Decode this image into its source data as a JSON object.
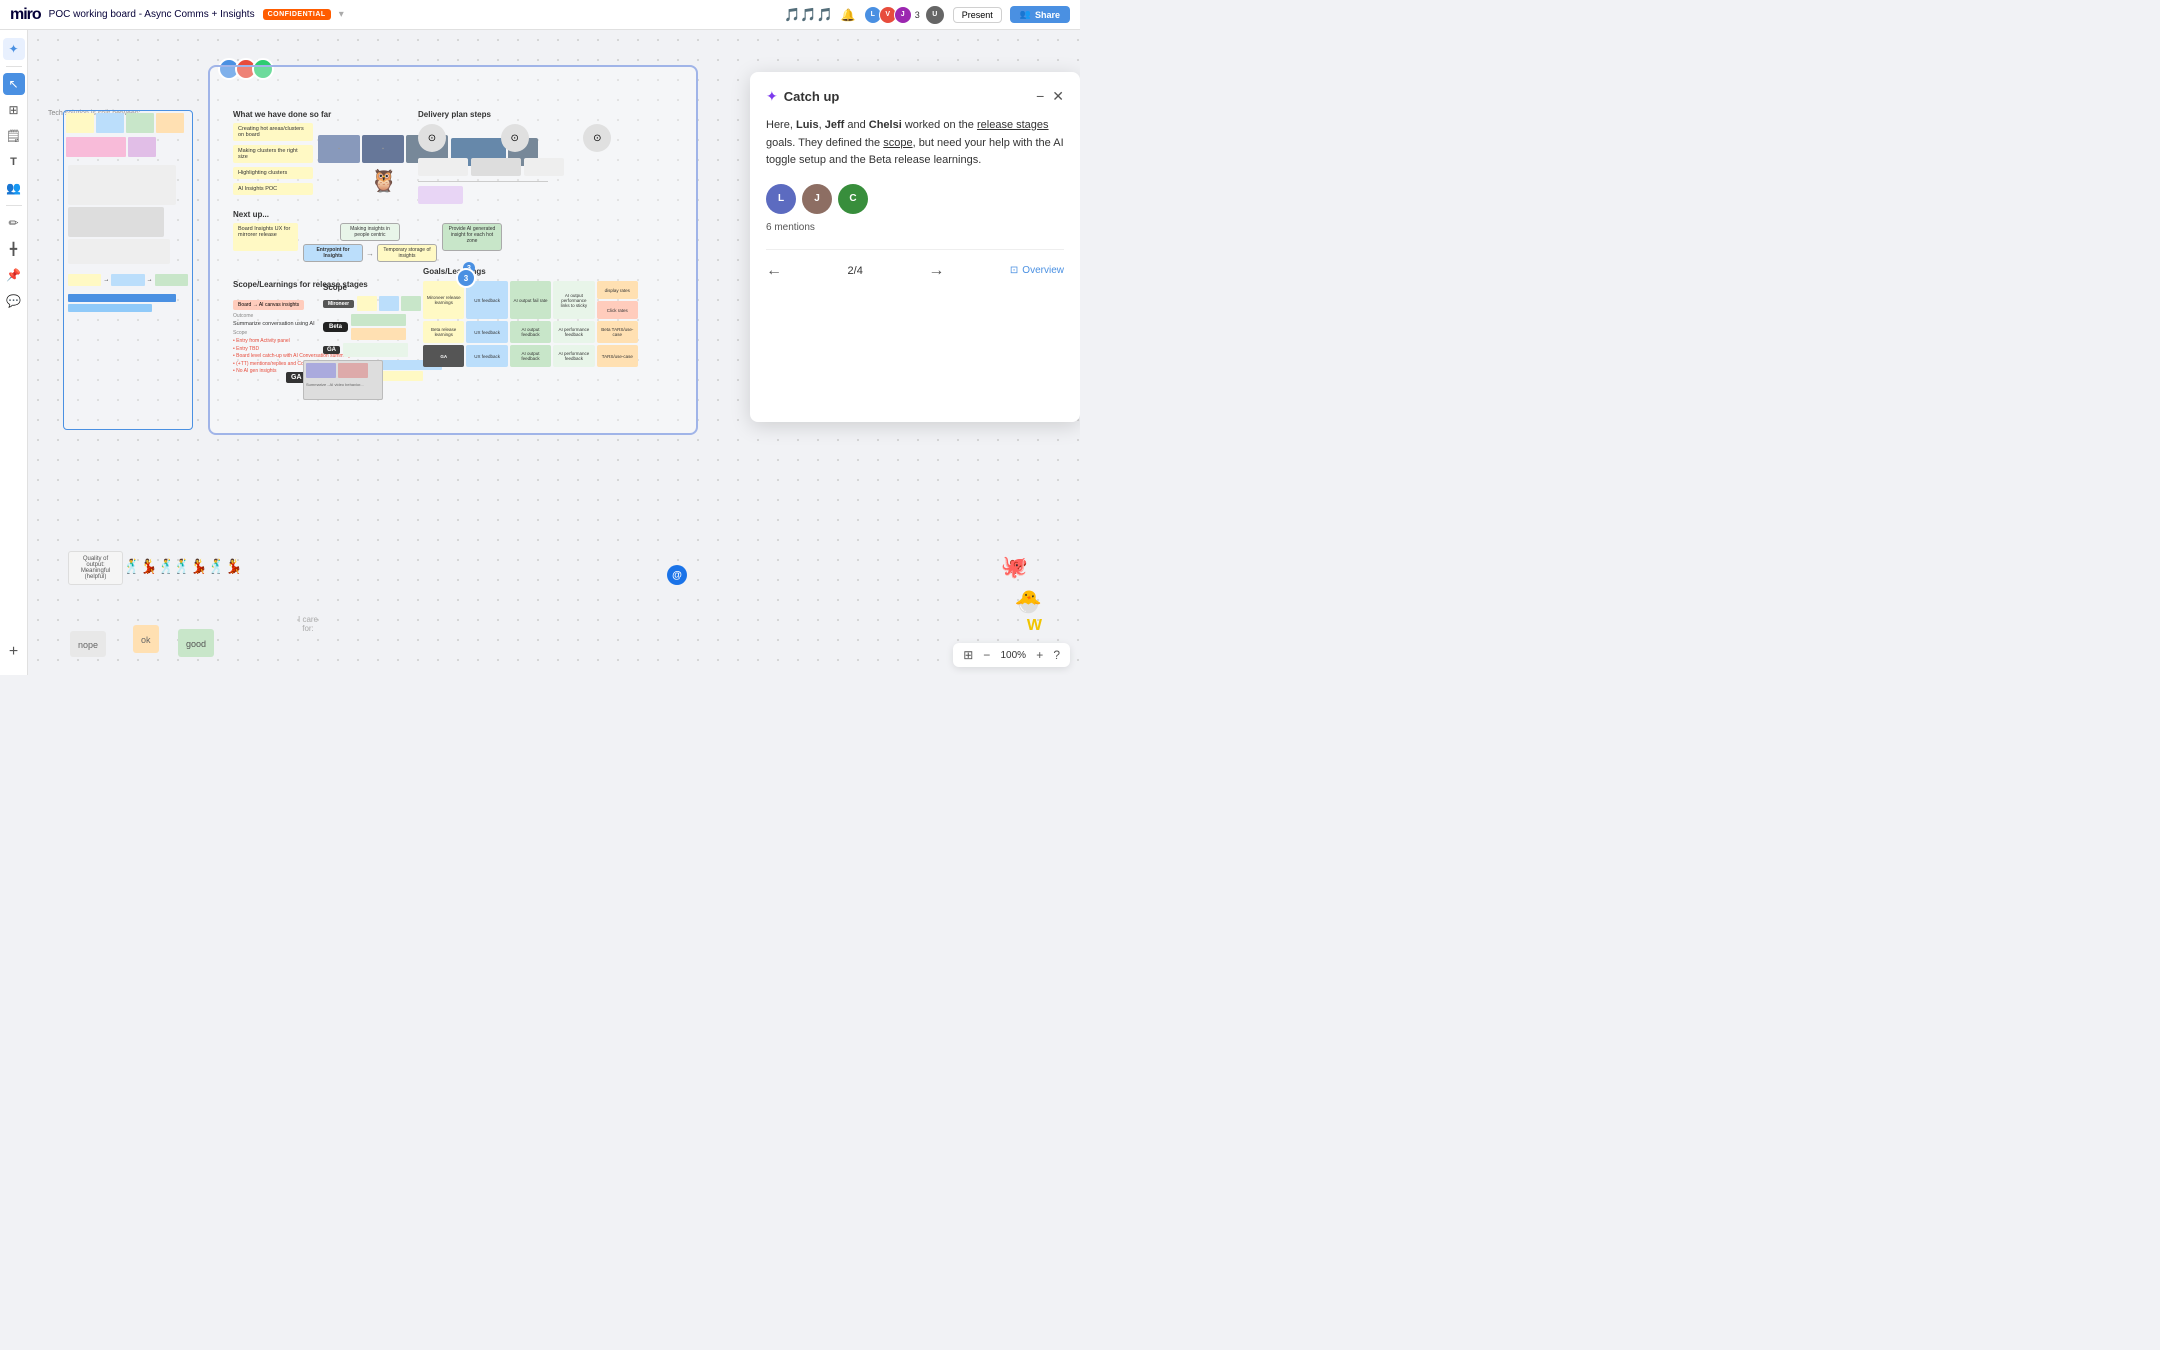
{
  "app": {
    "logo": "miro",
    "board_title": "POC working board - Async Comms + Insights",
    "confidential": "CONFIDENTIAL"
  },
  "topbar": {
    "present_label": "Present",
    "share_label": "Share",
    "user_count": "3"
  },
  "sidebar": {
    "icons": [
      {
        "name": "ai-sparkle-icon",
        "symbol": "✦",
        "active": true
      },
      {
        "name": "select-tool-icon",
        "symbol": "↖",
        "selected": true
      },
      {
        "name": "frames-icon",
        "symbol": "⊞"
      },
      {
        "name": "notes-icon",
        "symbol": "📝"
      },
      {
        "name": "text-icon",
        "symbol": "T"
      },
      {
        "name": "people-icon",
        "symbol": "👥"
      },
      {
        "name": "pen-icon",
        "symbol": "✏"
      },
      {
        "name": "ruler-icon",
        "symbol": "📐"
      },
      {
        "name": "pin-icon",
        "symbol": "📌"
      },
      {
        "name": "chat-icon",
        "symbol": "💬"
      }
    ]
  },
  "board": {
    "sections": {
      "done": {
        "title": "What we have done so far",
        "stickies": [
          "Creating hot areas/clusters on board",
          "Making clusters the right size",
          "Highlighting clusters",
          "AI Insights POC"
        ]
      },
      "next": {
        "title": "Next up...",
        "flow": [
          "Board Insights UX for mirrorer release",
          "Making insights in people centric",
          "Entrypoint for Insights",
          "Temporary storage of insights",
          "Provide AI generated insight for each hot zone"
        ]
      },
      "scope": {
        "title": "Scope/Learnings for release stages",
        "badge": "Board → AI canvas insights",
        "outcome_label": "Outcome",
        "outcome_text": "Summarize conversation using AI",
        "scope_label": "Scope",
        "items": [
          "Entry from Activity panel",
          "Entry TBD",
          "Board level catch-up with AI Conversation summary",
          "(+TT) mentions/replies and Conversation Board edits",
          "No AI gen insights"
        ]
      },
      "delivery": {
        "title": "Delivery plan steps"
      },
      "goals": {
        "title": "Goals/Learnings",
        "items": [
          "Mironeer release learnings",
          "UX feedback",
          "AI output fail rate",
          "AI output performance links to sticky",
          "display rates",
          "Click rates",
          "Beta release learnings",
          "UX feedback",
          "AI output feedback",
          "AI performance feedback",
          "Beta TARS/use-case",
          "GA",
          "UX feedback",
          "AI output feedback",
          "AI performance feedback",
          "TARS/use-case"
        ]
      }
    }
  },
  "catchup_panel": {
    "title": "Catch up",
    "body": {
      "prefix": "Here,",
      "names": [
        "Luis",
        "Jeff",
        "Chelsi"
      ],
      "text1": "worked on the",
      "link1": "release stages",
      "text2": "goals. They defined the",
      "link2": "scope",
      "text3": ", but need your help with the AI toggle setup and the Beta release learnings."
    },
    "mentions": "6 mentions",
    "navigation": {
      "current": "2",
      "total": "4"
    },
    "overview_label": "Overview"
  },
  "canvas": {
    "tech_text": "Tech solution is split between:",
    "bottom": {
      "quality_label": "Quality of output: Meaningful (helpful)",
      "nope": "nope",
      "ok": "ok",
      "good": "good",
      "i_care": "I care\nfor:"
    }
  },
  "zoom": {
    "level": "100%"
  },
  "colors": {
    "accent_blue": "#4a90e2",
    "accent_purple": "#7c3aed",
    "orange": "#ff5c00",
    "sticky_yellow": "#fff9c4",
    "sticky_blue": "#bbdefb",
    "sticky_green": "#c8e6c9",
    "sticky_orange": "#ffe0b2",
    "sticky_purple": "#e1bee7",
    "sticky_pink": "#f8bbd9",
    "avatar1": "#4a90e2",
    "avatar2": "#e74c3c",
    "avatar3": "#2ecc71",
    "catchup_avatar1": "#5c6bc0",
    "catchup_avatar2": "#8d6e63",
    "catchup_avatar3": "#388e3c"
  }
}
